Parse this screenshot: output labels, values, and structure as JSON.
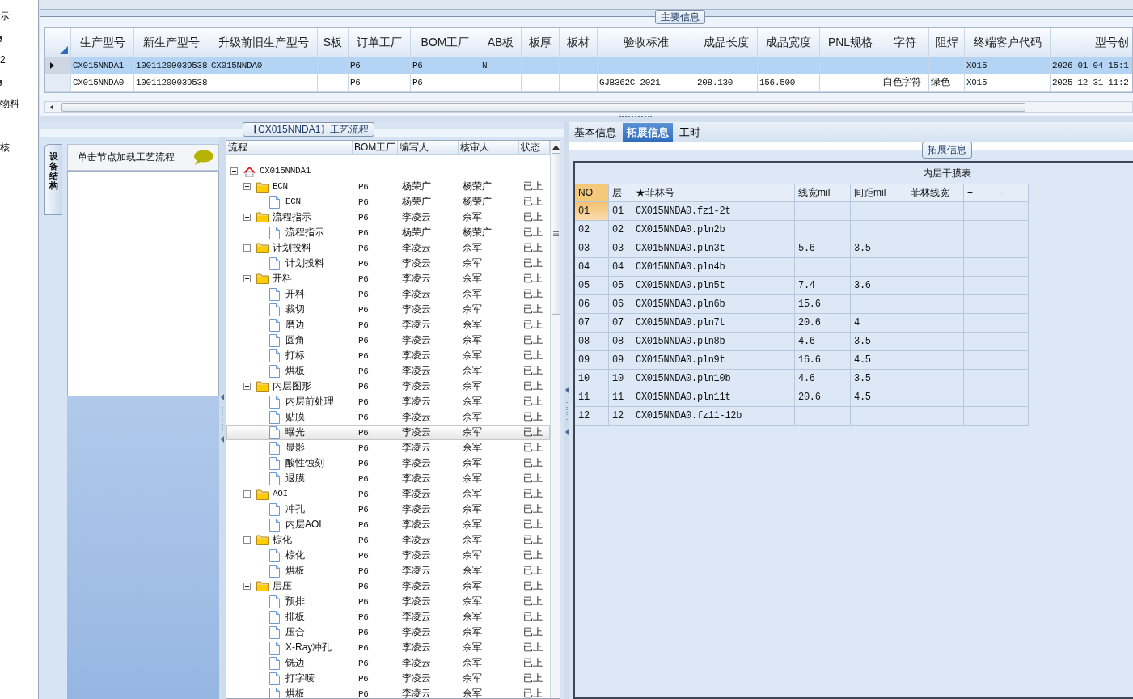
{
  "left_nav": [
    {
      "kind": "text",
      "label": "示"
    },
    {
      "kind": "mark"
    },
    {
      "kind": "text",
      "label": "2"
    },
    {
      "kind": "mark"
    },
    {
      "kind": "text",
      "label": "物料"
    },
    {
      "kind": "gap"
    },
    {
      "kind": "text",
      "label": "核"
    }
  ],
  "main_info": {
    "title": "主要信息",
    "columns": [
      "生产型号",
      "新生产型号",
      "升级前旧生产型号",
      "S板",
      "订单工厂",
      "BOM工厂",
      "AB板",
      "板厚",
      "板材",
      "验收标准",
      "成品长度",
      "成品宽度",
      "PNL规格",
      "字符",
      "阻焊",
      "终端客户代码",
      "型号创"
    ],
    "rows": [
      {
        "selected": true,
        "cells": [
          "CX015NNDA1",
          "10011200039538",
          "CX015NNDA0",
          null,
          "P6",
          "P6",
          "N",
          null,
          null,
          null,
          null,
          null,
          null,
          null,
          null,
          "X015",
          "2026-01-04 15:1"
        ]
      },
      {
        "selected": false,
        "cells": [
          "CX015NNDA0",
          "10011200039538",
          null,
          null,
          "P6",
          "P6",
          null,
          null,
          null,
          "GJB362C-2021",
          "208.130",
          "156.500",
          null,
          "白色字符",
          "绿色",
          "X015",
          "2025-12-31 11:2"
        ]
      }
    ]
  },
  "process_flow": {
    "title": "【CX015NNDA1】工艺流程",
    "side_tab": "设备结构",
    "hint": "单击节点加载工艺流程",
    "columns": [
      "流程",
      "BOM工厂",
      "编写人",
      "核审人",
      "状态"
    ],
    "tree": [
      {
        "kind": "root",
        "label": "CX015NNDA1",
        "expanded": true,
        "selected": false,
        "children": [
          {
            "kind": "folder",
            "label": "ECN",
            "bom": "P6",
            "writer": "杨荣广",
            "reviewer": "杨荣广",
            "status": "已上",
            "expanded": true,
            "selected": false,
            "children": [
              {
                "kind": "file",
                "label": "ECN",
                "bom": "P6",
                "writer": "杨荣广",
                "reviewer": "杨荣广",
                "status": "已上",
                "selected": false
              }
            ]
          },
          {
            "kind": "folder",
            "label": "流程指示",
            "bom": "P6",
            "writer": "李凌云",
            "reviewer": "佘军",
            "status": "已上",
            "expanded": true,
            "selected": false,
            "children": [
              {
                "kind": "file",
                "label": "流程指示",
                "bom": "P6",
                "writer": "杨荣广",
                "reviewer": "杨荣广",
                "status": "已上",
                "selected": false
              }
            ]
          },
          {
            "kind": "folder",
            "label": "计划投料",
            "bom": "P6",
            "writer": "李凌云",
            "reviewer": "佘军",
            "status": "已上",
            "expanded": true,
            "selected": false,
            "children": [
              {
                "kind": "file",
                "label": "计划投料",
                "bom": "P6",
                "writer": "李凌云",
                "reviewer": "佘军",
                "status": "已上",
                "selected": false
              }
            ]
          },
          {
            "kind": "folder",
            "label": "开料",
            "bom": "P6",
            "writer": "李凌云",
            "reviewer": "佘军",
            "status": "已上",
            "expanded": true,
            "selected": false,
            "children": [
              {
                "kind": "file",
                "label": "开料",
                "bom": "P6",
                "writer": "李凌云",
                "reviewer": "佘军",
                "status": "已上",
                "selected": false
              },
              {
                "kind": "file",
                "label": "裁切",
                "bom": "P6",
                "writer": "李凌云",
                "reviewer": "佘军",
                "status": "已上",
                "selected": false
              },
              {
                "kind": "file",
                "label": "磨边",
                "bom": "P6",
                "writer": "李凌云",
                "reviewer": "佘军",
                "status": "已上",
                "selected": false
              },
              {
                "kind": "file",
                "label": "圆角",
                "bom": "P6",
                "writer": "李凌云",
                "reviewer": "佘军",
                "status": "已上",
                "selected": false
              },
              {
                "kind": "file",
                "label": "打标",
                "bom": "P6",
                "writer": "李凌云",
                "reviewer": "佘军",
                "status": "已上",
                "selected": false
              },
              {
                "kind": "file",
                "label": "烘板",
                "bom": "P6",
                "writer": "李凌云",
                "reviewer": "佘军",
                "status": "已上",
                "selected": false
              }
            ]
          },
          {
            "kind": "folder",
            "label": "内层图形",
            "bom": "P6",
            "writer": "李凌云",
            "reviewer": "佘军",
            "status": "已上",
            "expanded": true,
            "selected": false,
            "children": [
              {
                "kind": "file",
                "label": "内层前处理",
                "bom": "P6",
                "writer": "李凌云",
                "reviewer": "佘军",
                "status": "已上",
                "selected": false
              },
              {
                "kind": "file",
                "label": "贴膜",
                "bom": "P6",
                "writer": "李凌云",
                "reviewer": "佘军",
                "status": "已上",
                "selected": false
              },
              {
                "kind": "file",
                "label": "曝光",
                "bom": "P6",
                "writer": "李凌云",
                "reviewer": "佘军",
                "status": "已上",
                "selected": true
              },
              {
                "kind": "file",
                "label": "显影",
                "bom": "P6",
                "writer": "李凌云",
                "reviewer": "佘军",
                "status": "已上",
                "selected": false
              },
              {
                "kind": "file",
                "label": "酸性蚀刻",
                "bom": "P6",
                "writer": "李凌云",
                "reviewer": "佘军",
                "status": "已上",
                "selected": false
              },
              {
                "kind": "file",
                "label": "退膜",
                "bom": "P6",
                "writer": "李凌云",
                "reviewer": "佘军",
                "status": "已上",
                "selected": false
              }
            ]
          },
          {
            "kind": "folder",
            "label": "AOI",
            "bom": "P6",
            "writer": "李凌云",
            "reviewer": "佘军",
            "status": "已上",
            "expanded": true,
            "selected": false,
            "children": [
              {
                "kind": "file",
                "label": "冲孔",
                "bom": "P6",
                "writer": "李凌云",
                "reviewer": "佘军",
                "status": "已上",
                "selected": false
              },
              {
                "kind": "file",
                "label": "内层AOI",
                "bom": "P6",
                "writer": "李凌云",
                "reviewer": "佘军",
                "status": "已上",
                "selected": false
              }
            ]
          },
          {
            "kind": "folder",
            "label": "棕化",
            "bom": "P6",
            "writer": "李凌云",
            "reviewer": "佘军",
            "status": "已上",
            "expanded": true,
            "selected": false,
            "children": [
              {
                "kind": "file",
                "label": "棕化",
                "bom": "P6",
                "writer": "李凌云",
                "reviewer": "佘军",
                "status": "已上",
                "selected": false
              },
              {
                "kind": "file",
                "label": "烘板",
                "bom": "P6",
                "writer": "李凌云",
                "reviewer": "佘军",
                "status": "已上",
                "selected": false
              }
            ]
          },
          {
            "kind": "folder",
            "label": "层压",
            "bom": "P6",
            "writer": "李凌云",
            "reviewer": "佘军",
            "status": "已上",
            "expanded": true,
            "selected": false,
            "children": [
              {
                "kind": "file",
                "label": "预排",
                "bom": "P6",
                "writer": "李凌云",
                "reviewer": "佘军",
                "status": "已上",
                "selected": false
              },
              {
                "kind": "file",
                "label": "排板",
                "bom": "P6",
                "writer": "李凌云",
                "reviewer": "佘军",
                "status": "已上",
                "selected": false
              },
              {
                "kind": "file",
                "label": "压合",
                "bom": "P6",
                "writer": "李凌云",
                "reviewer": "佘军",
                "status": "已上",
                "selected": false
              },
              {
                "kind": "file",
                "label": "X-Ray冲孔",
                "bom": "P6",
                "writer": "李凌云",
                "reviewer": "佘军",
                "status": "已上",
                "selected": false
              },
              {
                "kind": "file",
                "label": "铣边",
                "bom": "P6",
                "writer": "李凌云",
                "reviewer": "佘军",
                "status": "已上",
                "selected": false
              },
              {
                "kind": "file",
                "label": "打字唛",
                "bom": "P6",
                "writer": "李凌云",
                "reviewer": "佘军",
                "status": "已上",
                "selected": false
              },
              {
                "kind": "file",
                "label": "烘板",
                "bom": "P6",
                "writer": "李凌云",
                "reviewer": "佘军",
                "status": "已上",
                "selected": false
              }
            ]
          }
        ]
      }
    ]
  },
  "detail": {
    "tabs": [
      {
        "label": "基本信息",
        "selected": false
      },
      {
        "label": "拓展信息",
        "selected": true
      },
      {
        "label": "工时",
        "selected": false
      }
    ],
    "group_title": "拓展信息",
    "table": {
      "title": "内层干膜表",
      "columns": [
        "NO",
        "层",
        "★菲林号",
        "线宽mil",
        "间距mil",
        "菲林线宽",
        "+",
        "-"
      ],
      "rows": [
        {
          "selected": true,
          "cells": [
            "01",
            "01",
            "CX015NNDA0.fz1-2t",
            null,
            null
          ]
        },
        {
          "selected": false,
          "cells": [
            "02",
            "02",
            "CX015NNDA0.pln2b",
            null,
            null
          ]
        },
        {
          "selected": false,
          "cells": [
            "03",
            "03",
            "CX015NNDA0.pln3t",
            "5.6",
            "3.5"
          ]
        },
        {
          "selected": false,
          "cells": [
            "04",
            "04",
            "CX015NNDA0.pln4b",
            null,
            null
          ]
        },
        {
          "selected": false,
          "cells": [
            "05",
            "05",
            "CX015NNDA0.pln5t",
            "7.4",
            "3.6"
          ]
        },
        {
          "selected": false,
          "cells": [
            "06",
            "06",
            "CX015NNDA0.pln6b",
            "15.6",
            null
          ]
        },
        {
          "selected": false,
          "cells": [
            "07",
            "07",
            "CX015NNDA0.pln7t",
            "20.6",
            "4"
          ]
        },
        {
          "selected": false,
          "cells": [
            "08",
            "08",
            "CX015NNDA0.pln8b",
            "4.6",
            "3.5"
          ]
        },
        {
          "selected": false,
          "cells": [
            "09",
            "09",
            "CX015NNDA0.pln9t",
            "16.6",
            "4.5"
          ]
        },
        {
          "selected": false,
          "cells": [
            "10",
            "10",
            "CX015NNDA0.pln10b",
            "4.6",
            "3.5"
          ]
        },
        {
          "selected": false,
          "cells": [
            "11",
            "11",
            "CX015NNDA0.pln11t",
            "20.6",
            "4.5"
          ]
        },
        {
          "selected": false,
          "cells": [
            "12",
            "12",
            "CX015NNDA0.fz11-12b",
            null,
            null
          ]
        }
      ]
    }
  }
}
